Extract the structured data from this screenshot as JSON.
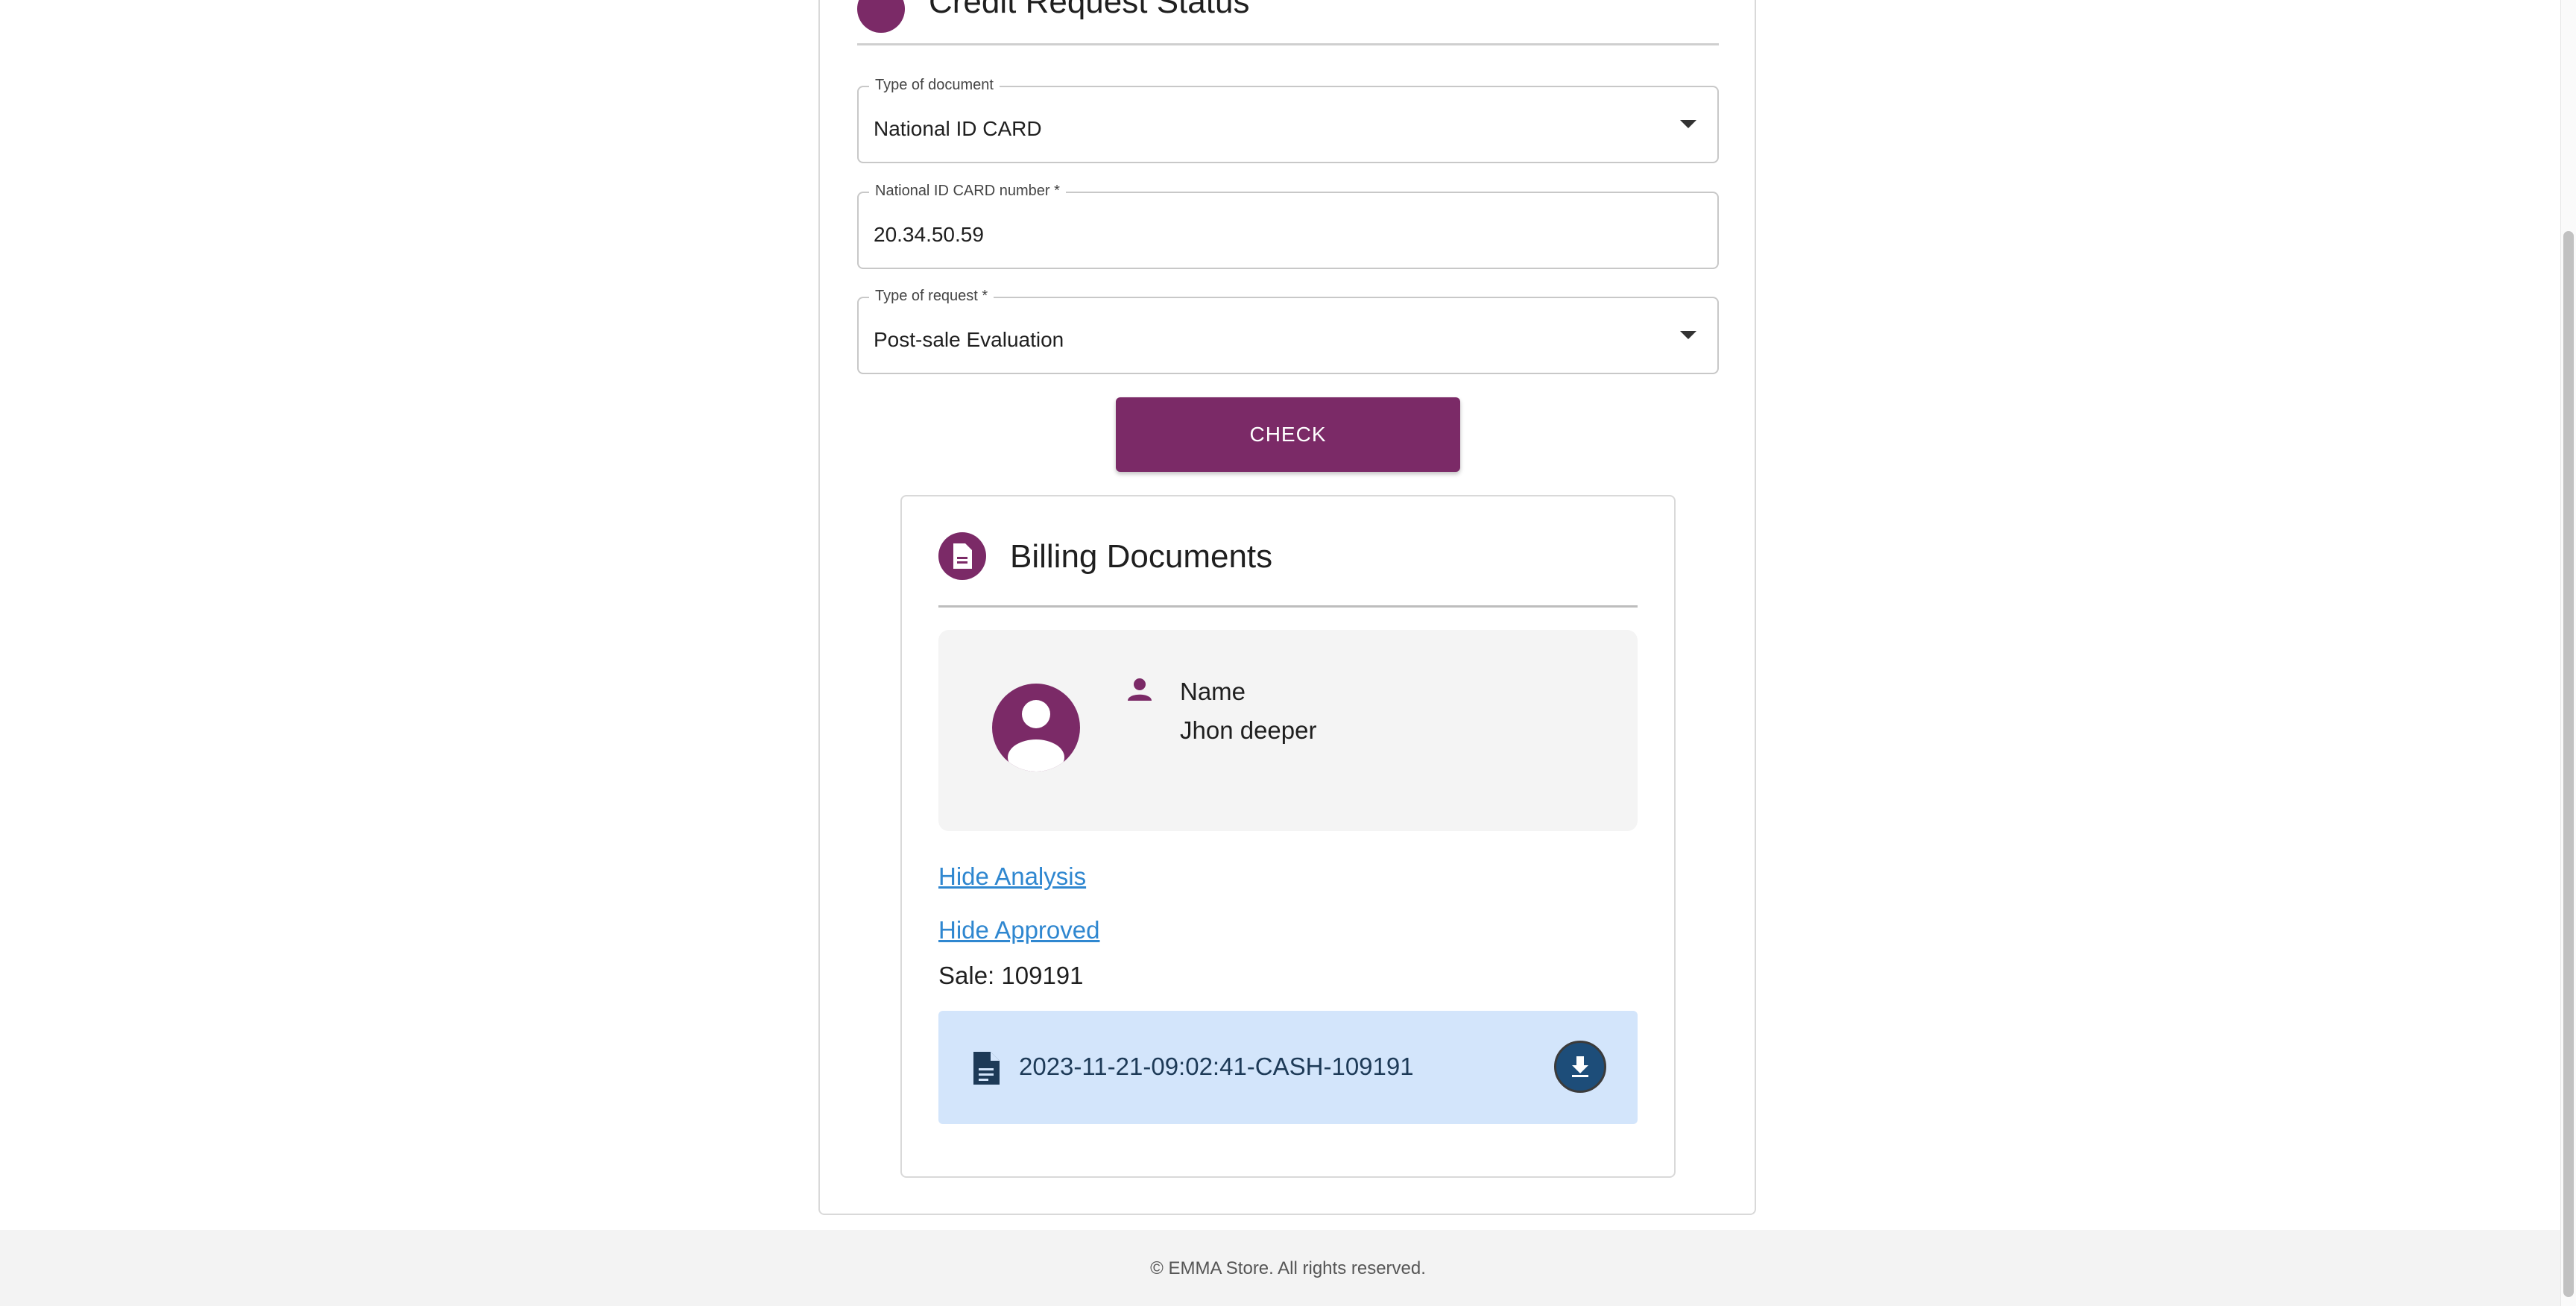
{
  "header": {
    "title": "Credit Request Status"
  },
  "form": {
    "document_type": {
      "label": "Type of document",
      "value": "National ID CARD"
    },
    "id_number": {
      "label": "National ID CARD number *",
      "value": "20.34.50.59"
    },
    "request_type": {
      "label": "Type of request *",
      "value": "Post-sale Evaluation"
    },
    "check_label": "CHECK"
  },
  "billing": {
    "title": "Billing Documents",
    "name_label": "Name",
    "name_value": "Jhon deeper",
    "hide_analysis": "Hide Analysis",
    "hide_approved": "Hide Approved",
    "sale": "Sale: 109191",
    "file_name": "2023-11-21-09:02:41-CASH-109191"
  },
  "footer": {
    "copyright": "© EMMA Store. All rights reserved."
  },
  "colors": {
    "primary": "#7b2a67",
    "link": "#2f87d0",
    "file_bg": "#d3e5fb",
    "download": "#1d4d79"
  }
}
